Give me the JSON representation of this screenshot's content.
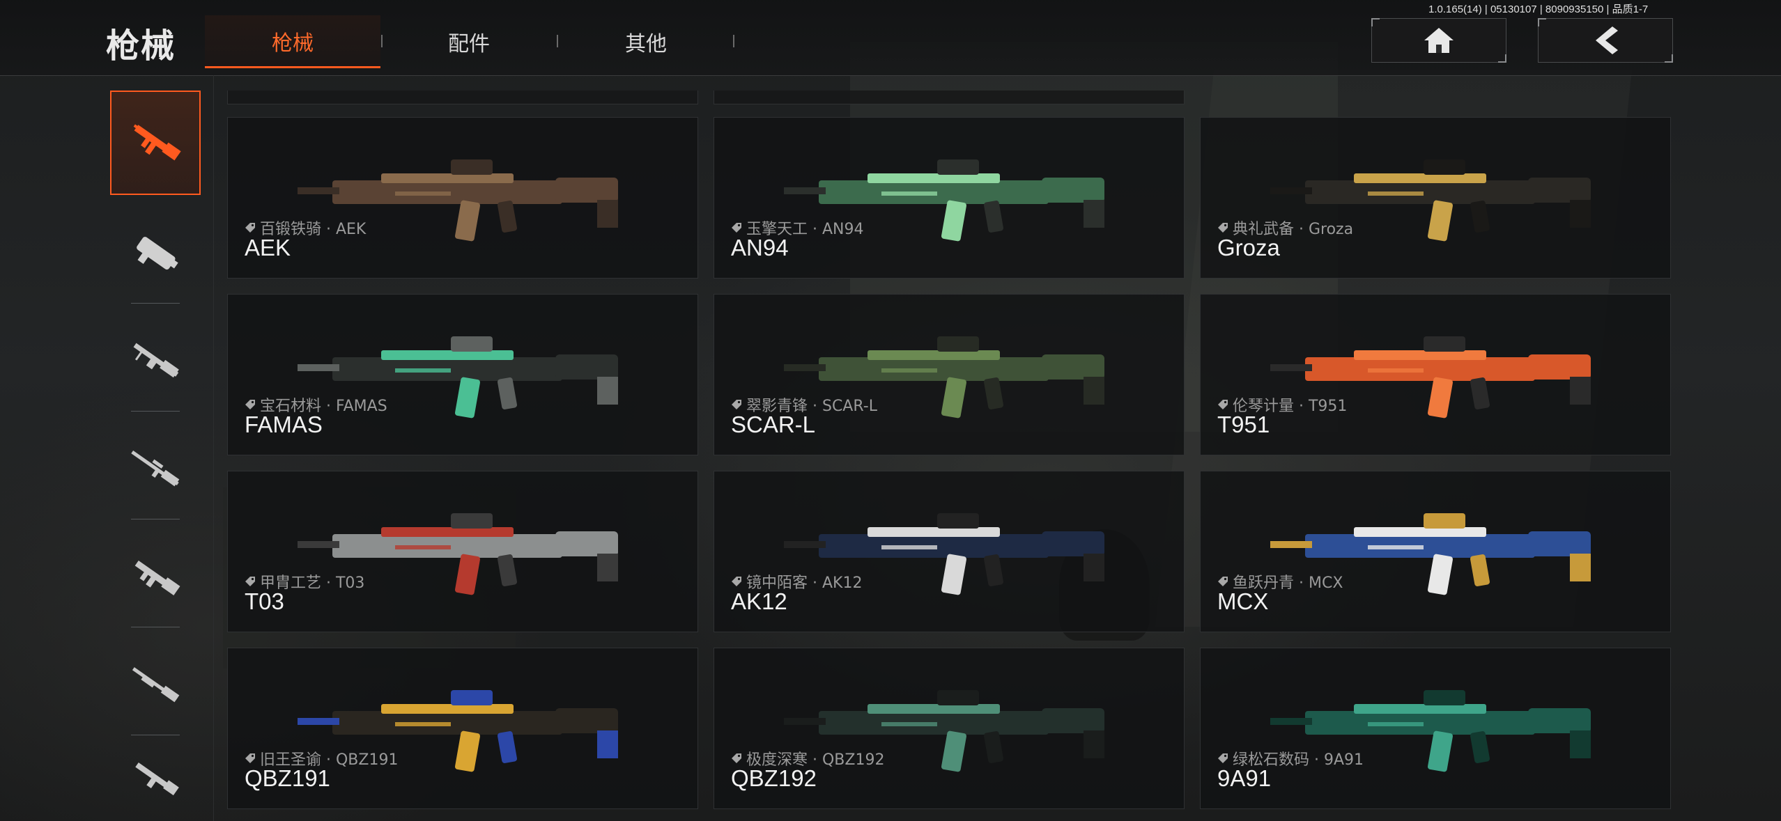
{
  "header": {
    "page_title": "枪械",
    "tabs": [
      {
        "label": "枪械",
        "active": true
      },
      {
        "label": "配件",
        "active": false
      },
      {
        "label": "其他",
        "active": false
      }
    ],
    "version_text": "1.0.165(14) | 05130107 | 8090935150 | 品质1-7",
    "home_icon": "home-icon",
    "back_icon": "back-arrow-icon"
  },
  "sidebar": {
    "categories": [
      {
        "icon": "assault-rifle-icon",
        "active": true
      },
      {
        "icon": "smg-icon",
        "active": false
      },
      {
        "icon": "lmg-icon",
        "active": false
      },
      {
        "icon": "sniper-rifle-icon",
        "active": false
      },
      {
        "icon": "carbine-icon",
        "active": false
      },
      {
        "icon": "shotgun-icon",
        "active": false
      },
      {
        "icon": "pistol-icon",
        "active": false
      }
    ]
  },
  "colors": {
    "accent": "#ff5a1f",
    "card_bg": "#121314",
    "text": "#f2f2f2"
  },
  "weapons": [
    {
      "skin": "百锻铁骑 · AEK",
      "name": "AEK",
      "colors": [
        "#5a4334",
        "#8a6b4c",
        "#3a2e26"
      ]
    },
    {
      "skin": "玉擎天工 · AN94",
      "name": "AN94",
      "colors": [
        "#3c6b4d",
        "#8fd6a0",
        "#2b2f2c"
      ]
    },
    {
      "skin": "典礼武备 · Groza",
      "name": "Groza",
      "colors": [
        "#2a2824",
        "#c9a34a",
        "#1a1917"
      ]
    },
    {
      "skin": "宝石材料 · FAMAS",
      "name": "FAMAS",
      "colors": [
        "#2b2f2d",
        "#4bbf94",
        "#5d615f"
      ]
    },
    {
      "skin": "翠影青锋 · SCAR-L",
      "name": "SCAR-L",
      "colors": [
        "#3f5237",
        "#6b8a52",
        "#272b24"
      ]
    },
    {
      "skin": "伦琴计量 · T951",
      "name": "T951",
      "colors": [
        "#d8582a",
        "#f07a3e",
        "#2a2a2a"
      ]
    },
    {
      "skin": "甲胄工艺 · T03",
      "name": "T03",
      "colors": [
        "#8c8f8f",
        "#b53a2e",
        "#3a3a3a"
      ]
    },
    {
      "skin": "镜中陌客 · AK12",
      "name": "AK12",
      "colors": [
        "#1e2a44",
        "#d9d9d9",
        "#222222"
      ]
    },
    {
      "skin": "鱼跃丹青 · MCX",
      "name": "MCX",
      "colors": [
        "#2d4f96",
        "#e8e8e8",
        "#c79a3a"
      ]
    },
    {
      "skin": "旧王圣谕 · QBZ191",
      "name": "QBZ191",
      "colors": [
        "#2a2620",
        "#d9a532",
        "#2c47a8"
      ]
    },
    {
      "skin": "极度深寒 · QBZ192",
      "name": "QBZ192",
      "colors": [
        "#23302c",
        "#4f8f78",
        "#1a1d1c"
      ]
    },
    {
      "skin": "绿松石数码 · 9A91",
      "name": "9A91",
      "colors": [
        "#1d5a4c",
        "#3fa58a",
        "#123a30"
      ]
    }
  ]
}
